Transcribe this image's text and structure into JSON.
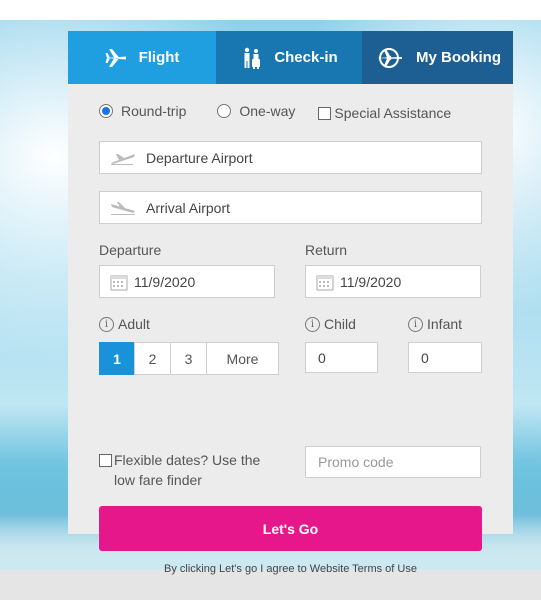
{
  "tabs": {
    "flight": "Flight",
    "checkin": "Check-in",
    "booking": "My Booking"
  },
  "trip": {
    "round": "Round-trip",
    "oneway": "One-way",
    "assist": "Special Assistance",
    "selected": "round"
  },
  "airports": {
    "departure": "Departure Airport",
    "arrival": "Arrival Airport"
  },
  "dates": {
    "departure_label": "Departure",
    "departure_value": "11/9/2020",
    "return_label": "Return",
    "return_value": "11/9/2020"
  },
  "passengers": {
    "adult_label": "Adult",
    "adult_options": [
      "1",
      "2",
      "3",
      "More"
    ],
    "adult_selected": "1",
    "child_label": "Child",
    "child_value": "0",
    "infant_label": "Infant",
    "infant_value": "0",
    "info_glyph": "i"
  },
  "options": {
    "flexible": "Flexible dates? Use the low fare finder",
    "promo_placeholder": "Promo code"
  },
  "actions": {
    "go": "Let's Go",
    "terms": "By clicking Let's go I agree to Website Terms of Use"
  },
  "colors": {
    "tab_flight": "#1f9ee0",
    "tab_checkin": "#1877b1",
    "tab_booking": "#1e5f93",
    "go_button": "#e6178b",
    "selected_pax": "#1a92da"
  }
}
